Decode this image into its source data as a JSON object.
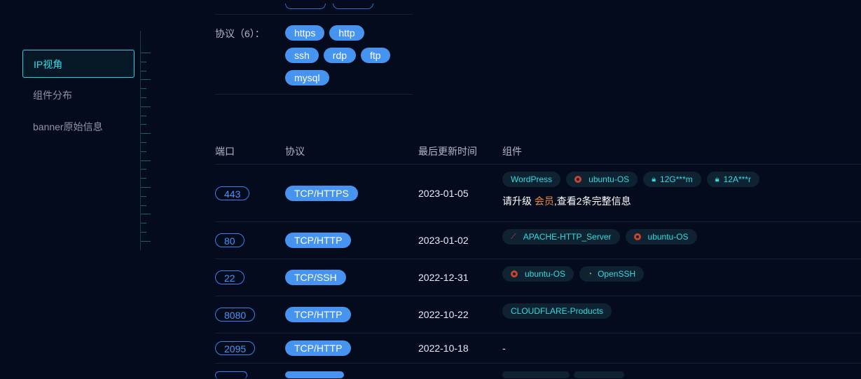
{
  "nav": {
    "items": [
      {
        "label": "IP视角",
        "active": true
      },
      {
        "label": "组件分布",
        "active": false
      },
      {
        "label": "banner原始信息",
        "active": false
      }
    ]
  },
  "protocols": {
    "label": "协议（6）：",
    "tags": [
      "https",
      "http",
      "ssh",
      "rdp",
      "ftp",
      "mysql"
    ]
  },
  "table": {
    "headers": {
      "port": "端口",
      "protocol": "协议",
      "updated": "最后更新时间",
      "components": "组件"
    },
    "rows": [
      {
        "port": "443",
        "protocol": "TCP/HTTPS",
        "date": "2023-01-05",
        "components": [
          {
            "icon": "none",
            "name": "WordPress"
          },
          {
            "icon": "ubuntu-icon",
            "name": "ubuntu-OS"
          },
          {
            "icon": "lock-icon",
            "name": "12G***m"
          },
          {
            "icon": "lock-icon",
            "name": "12A***r"
          }
        ],
        "upgrade": {
          "prefix": "请升级 ",
          "vip": "会员",
          "suffix": ",查看2条完整信息"
        }
      },
      {
        "port": "80",
        "protocol": "TCP/HTTP",
        "date": "2023-01-02",
        "components": [
          {
            "icon": "feather-icon",
            "name": "APACHE-HTTP_Server"
          },
          {
            "icon": "ubuntu-icon",
            "name": "ubuntu-OS"
          }
        ]
      },
      {
        "port": "22",
        "protocol": "TCP/SSH",
        "date": "2022-12-31",
        "components": [
          {
            "icon": "ubuntu-icon",
            "name": "ubuntu-OS"
          },
          {
            "icon": "openssh-icon",
            "name": "OpenSSH"
          }
        ]
      },
      {
        "port": "8080",
        "protocol": "TCP/HTTP",
        "date": "2022-10-22",
        "components": [
          {
            "icon": "none",
            "name": "CLOUDFLARE-Products"
          }
        ]
      },
      {
        "port": "2095",
        "protocol": "TCP/HTTP",
        "date": "2022-10-18",
        "components": [],
        "empty": "-"
      }
    ]
  },
  "colors": {
    "accent": "#27e0ee",
    "tag_blue": "#4694f0",
    "component_text": "#2fdcdf",
    "vip_orange": "#f08a3c",
    "background": "#030b1c"
  }
}
